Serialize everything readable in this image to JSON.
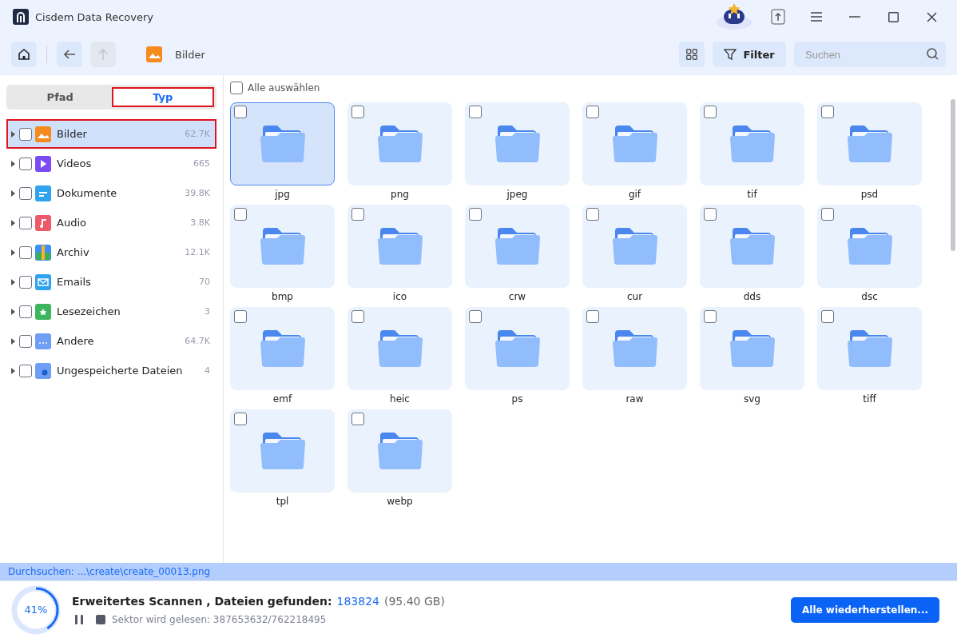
{
  "window": {
    "title": "Cisdem Data Recovery"
  },
  "toolbar": {
    "location": "Bilder",
    "filter_label": "Filter",
    "search": {
      "placeholder": "Suchen"
    }
  },
  "tabs": [
    {
      "label": "Pfad",
      "selected": false
    },
    {
      "label": "Typ",
      "selected": true
    }
  ],
  "categories": [
    {
      "kind": "image",
      "label": "Bilder",
      "count": "62.7K",
      "checked": false,
      "selected": true
    },
    {
      "kind": "video",
      "label": "Videos",
      "count": "665",
      "checked": false,
      "selected": false
    },
    {
      "kind": "document",
      "label": "Dokumente",
      "count": "39.8K",
      "checked": false,
      "selected": false
    },
    {
      "kind": "audio",
      "label": "Audio",
      "count": "3.8K",
      "checked": false,
      "selected": false
    },
    {
      "kind": "archive",
      "label": "Archiv",
      "count": "12.1K",
      "checked": false,
      "selected": false
    },
    {
      "kind": "email",
      "label": "Emails",
      "count": "70",
      "checked": false,
      "selected": false
    },
    {
      "kind": "bookmark",
      "label": "Lesezeichen",
      "count": "3",
      "checked": false,
      "selected": false
    },
    {
      "kind": "other",
      "label": "Andere",
      "count": "64.7K",
      "checked": false,
      "selected": false
    },
    {
      "kind": "unsaved",
      "label": "Ungespeicherte Dateien",
      "count": "4",
      "checked": false,
      "selected": false
    }
  ],
  "select_all": {
    "label": "Alle auswählen",
    "checked": false
  },
  "folders": [
    {
      "name": "jpg",
      "checked": false,
      "selected": true
    },
    {
      "name": "png",
      "checked": false,
      "selected": false
    },
    {
      "name": "jpeg",
      "checked": false,
      "selected": false
    },
    {
      "name": "gif",
      "checked": false,
      "selected": false
    },
    {
      "name": "tif",
      "checked": false,
      "selected": false
    },
    {
      "name": "psd",
      "checked": false,
      "selected": false
    },
    {
      "name": "bmp",
      "checked": false,
      "selected": false
    },
    {
      "name": "ico",
      "checked": false,
      "selected": false
    },
    {
      "name": "crw",
      "checked": false,
      "selected": false
    },
    {
      "name": "cur",
      "checked": false,
      "selected": false
    },
    {
      "name": "dds",
      "checked": false,
      "selected": false
    },
    {
      "name": "dsc",
      "checked": false,
      "selected": false
    },
    {
      "name": "emf",
      "checked": false,
      "selected": false
    },
    {
      "name": "heic",
      "checked": false,
      "selected": false
    },
    {
      "name": "ps",
      "checked": false,
      "selected": false
    },
    {
      "name": "raw",
      "checked": false,
      "selected": false
    },
    {
      "name": "svg",
      "checked": false,
      "selected": false
    },
    {
      "name": "tiff",
      "checked": false,
      "selected": false
    },
    {
      "name": "tpl",
      "checked": false,
      "selected": false
    },
    {
      "name": "webp",
      "checked": false,
      "selected": false
    }
  ],
  "scan_path": "Durchsuchen: ...\\create\\create_00013.png",
  "scan": {
    "level": 0.41,
    "percent": "41%",
    "title": "Erweitertes Scannen , Dateien gefunden:",
    "found": "183824",
    "size": "(95.40 GB)",
    "sector": "Sektor wird gelesen: 387653632/762218495"
  },
  "restore_button": "Alle wiederherstellen..."
}
